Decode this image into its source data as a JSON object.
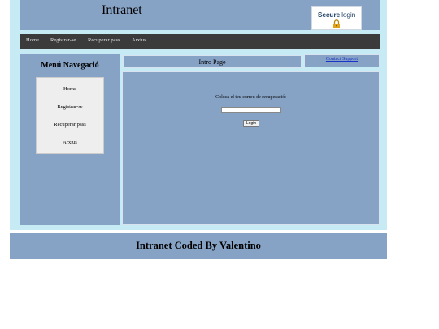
{
  "header": {
    "title": "Intranet",
    "secure_badge": {
      "word1": "Secure",
      "word2": "login",
      "icon": "lock-icon"
    }
  },
  "nav": {
    "items": [
      {
        "label": "Home"
      },
      {
        "label": "Registrar-se"
      },
      {
        "label": "Recuperar pass"
      },
      {
        "label": "Arxius"
      }
    ]
  },
  "sidebar": {
    "title": "Menú Navegació",
    "items": [
      {
        "label": "Home"
      },
      {
        "label": "Registrar-se"
      },
      {
        "label": "Recuperar pass"
      },
      {
        "label": "Arxius"
      }
    ]
  },
  "content": {
    "intro_title": "Intro Page",
    "contact_link": "Contact Support",
    "form": {
      "label": "Coloca el teu correu de recuperació:",
      "email_value": "",
      "button": "Login"
    }
  },
  "footer": {
    "text": "Intranet Coded By Valentino"
  },
  "colors": {
    "panel": "#86a2c5",
    "outer_bg": "#c7ebf5",
    "navbar": "#3b3b3b",
    "link": "#1a34c8",
    "lock": "#e0a21b"
  }
}
